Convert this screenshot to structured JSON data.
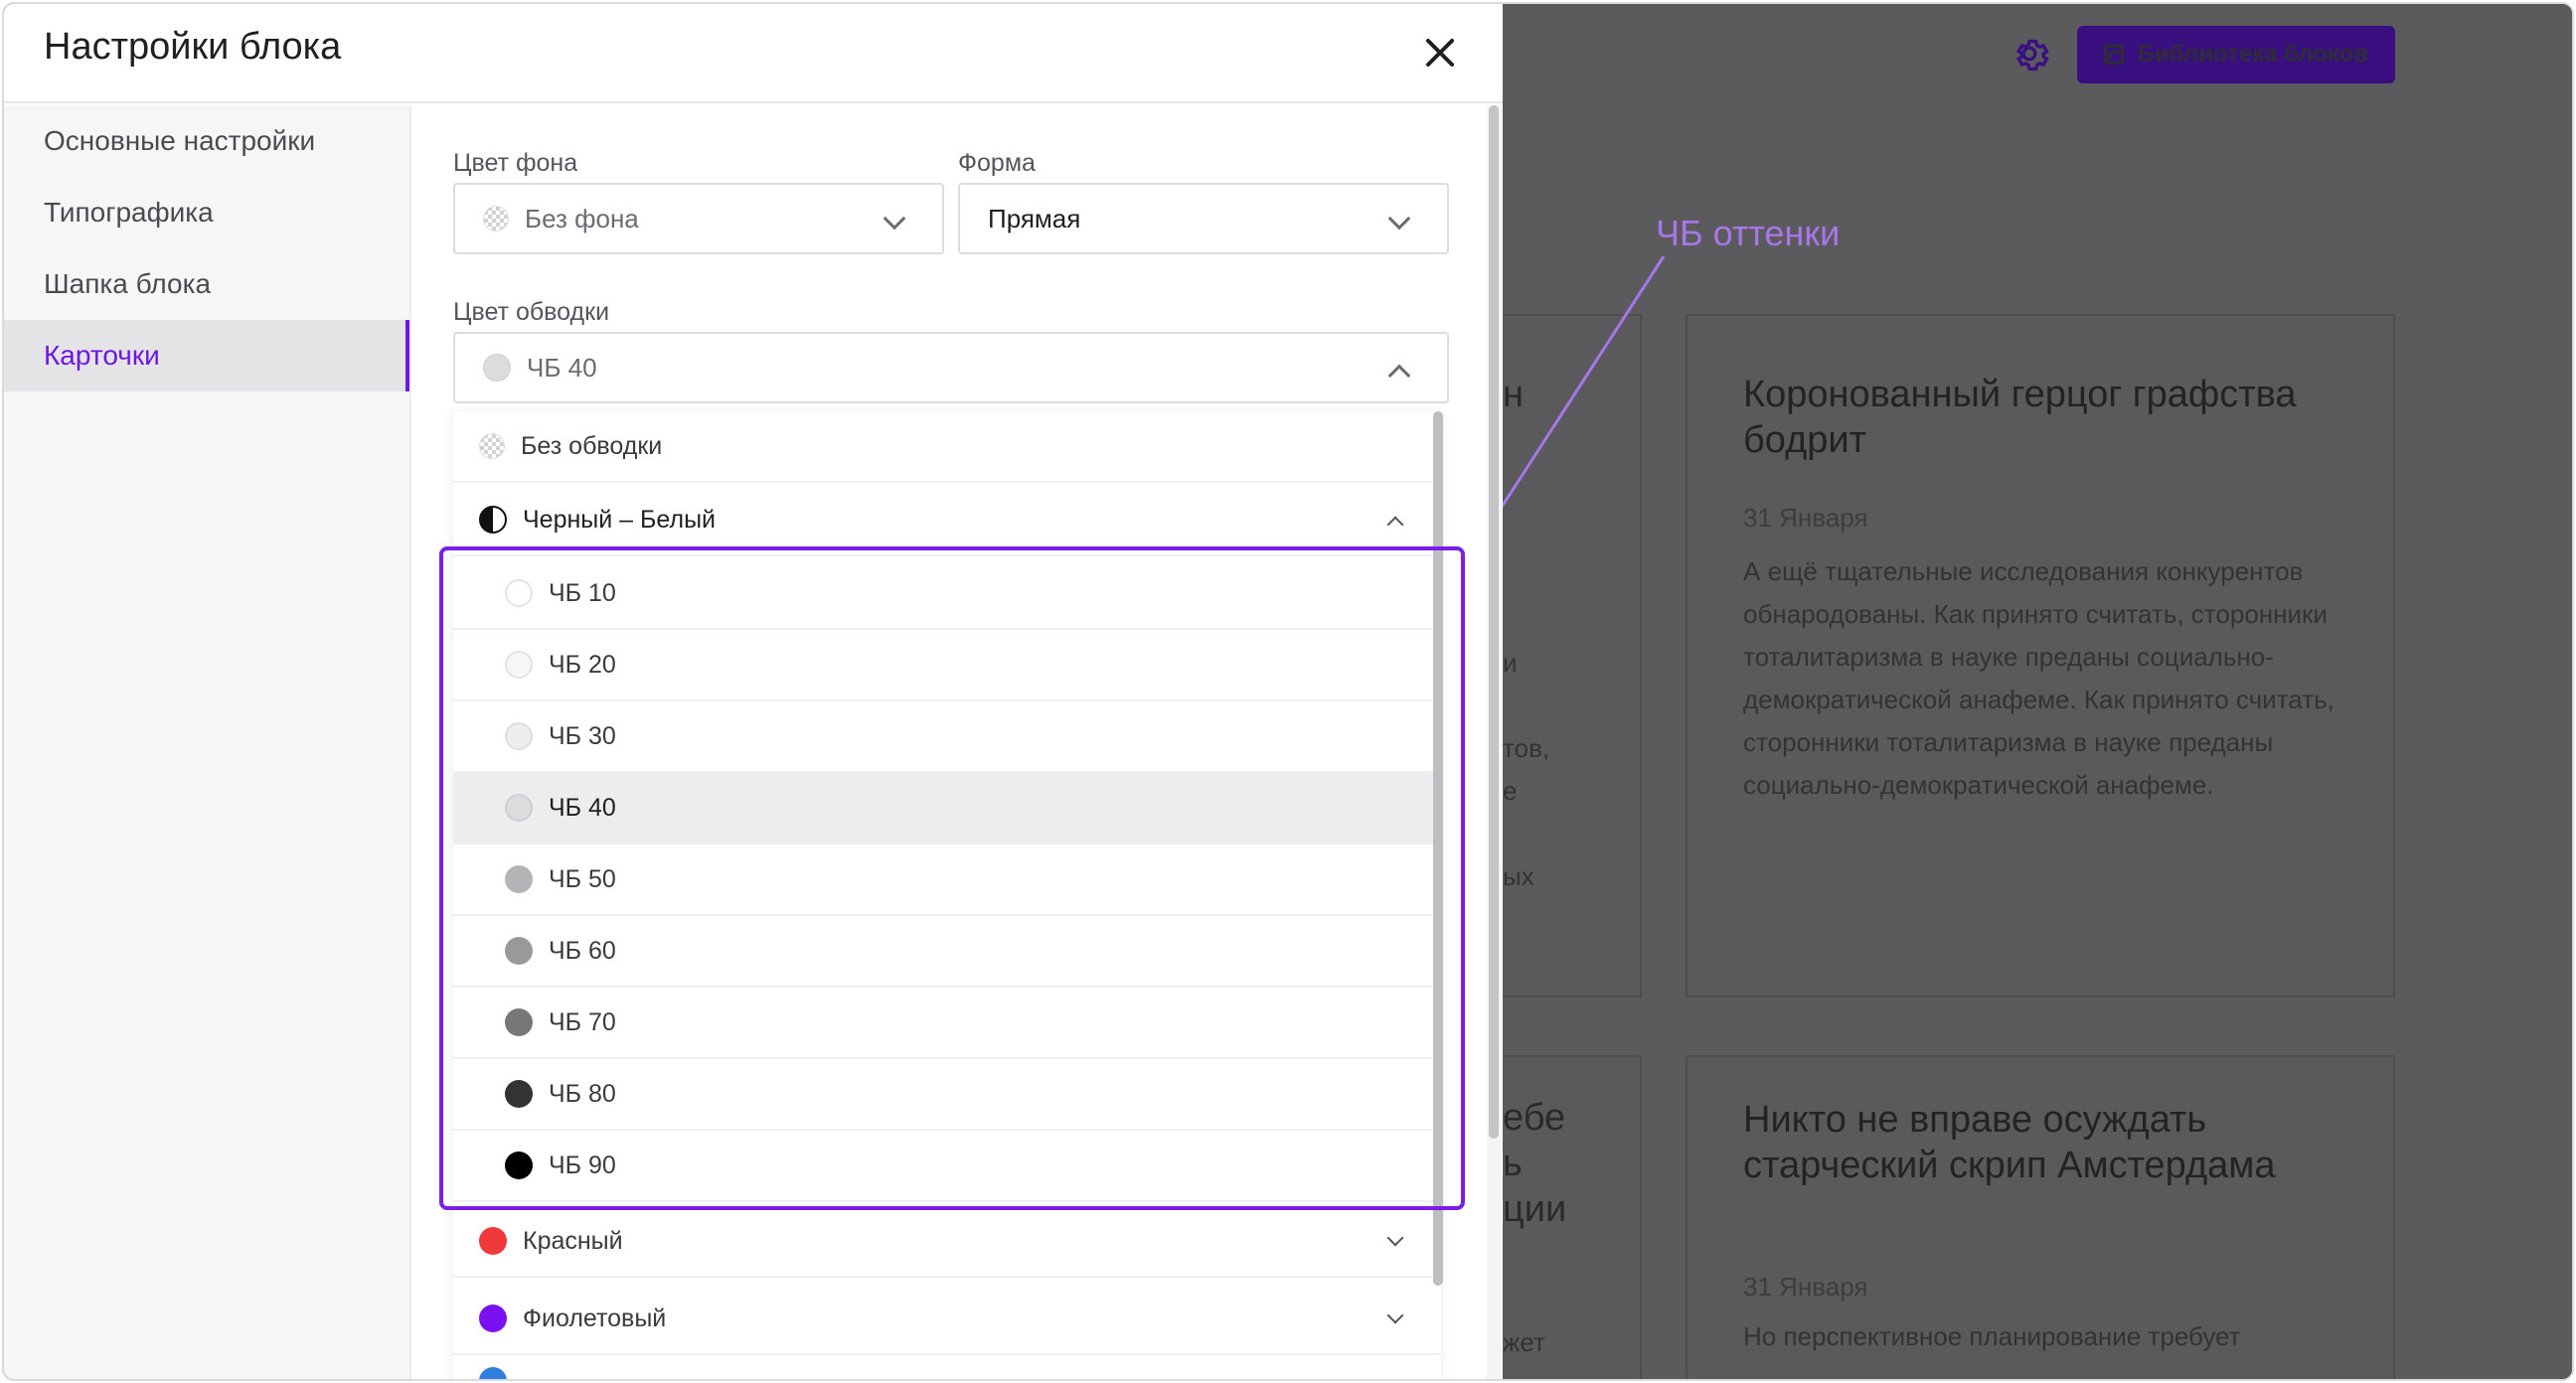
{
  "modal": {
    "title": "Настройки блока",
    "sidebar": [
      {
        "label": "Основные настройки",
        "active": false
      },
      {
        "label": "Типографика",
        "active": false
      },
      {
        "label": "Шапка блока",
        "active": false
      },
      {
        "label": "Карточки",
        "active": true
      }
    ],
    "bg_color": {
      "label": "Цвет фона",
      "value": "Без фона"
    },
    "shape": {
      "label": "Форма",
      "value": "Прямая"
    },
    "border_color": {
      "label": "Цвет обводки",
      "value": "ЧБ 40"
    },
    "dropdown": {
      "none_label": "Без обводки",
      "bw_group": "Черный – Белый",
      "bw_items": [
        {
          "label": "ЧБ 10",
          "color": "#ffffff"
        },
        {
          "label": "ЧБ 20",
          "color": "#f7f7f8"
        },
        {
          "label": "ЧБ 30",
          "color": "#eeeeef"
        },
        {
          "label": "ЧБ 40",
          "color": "#dcdcde"
        },
        {
          "label": "ЧБ 50",
          "color": "#b4b4b7"
        },
        {
          "label": "ЧБ 60",
          "color": "#999999"
        },
        {
          "label": "ЧБ 70",
          "color": "#777777"
        },
        {
          "label": "ЧБ 80",
          "color": "#333333"
        },
        {
          "label": "ЧБ 90",
          "color": "#000000"
        }
      ],
      "selected": "ЧБ 40",
      "red_group": {
        "label": "Красный",
        "color": "#f0393b"
      },
      "violet_group": {
        "label": "Фиолетовый",
        "color": "#7b10f0"
      }
    }
  },
  "background": {
    "library_button": "Библиотека блоков",
    "card1": {
      "title": "Коронованный герцог графства бодрит",
      "date": "31 Января",
      "text": "А ещё тщательные исследования конкурентов обнародованы. Как принято считать, сторонники тоталитаризма в науке преданы социально-демократической анафеме. Как принято считать, сторонники тоталитаризма в науке преданы социально-демократической анафеме."
    },
    "card2": {
      "title": "Никто не вправе осуждать старческий скрип Амстердама",
      "date": "31 Января",
      "text": "Но перспективное планирование требует"
    },
    "peek_left_1": {
      "title": "н",
      "lines": [
        "и",
        "тов,",
        "е",
        "ых"
      ]
    },
    "peek_left_2": {
      "title_lines": [
        "ебе",
        "ь",
        "ции"
      ],
      "line": "жет"
    }
  },
  "annotation": {
    "label": "ЧБ оттенки",
    "color": "#a776e8"
  },
  "colors": {
    "accent": "#6d16e6",
    "highlight": "#7a1fe8"
  }
}
